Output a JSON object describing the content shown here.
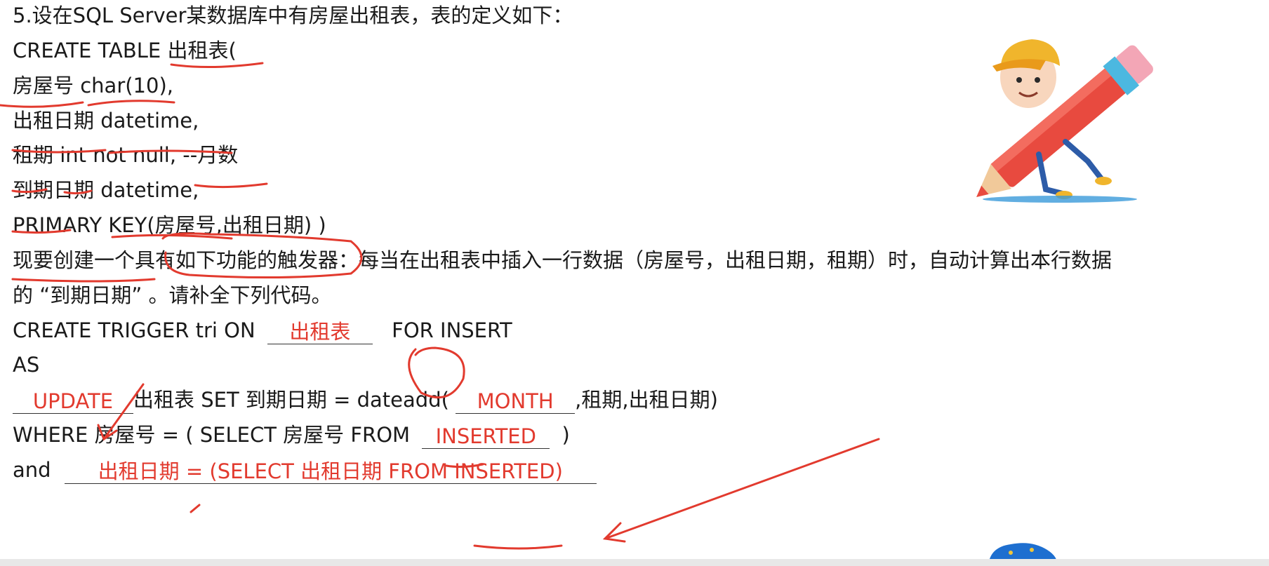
{
  "question": {
    "intro": "5.设在SQL Server某数据库中有房屋出租表，表的定义如下：",
    "create_table": "CREATE TABLE 出租表(",
    "col1": "房屋号 char(10),",
    "col2": "出租日期 datetime,",
    "col3": "租期 int not null, --月数",
    "col4": "到期日期 datetime,",
    "pk": "PRIMARY KEY(房屋号,出租日期) )",
    "desc1": "现要创建一个具有如下功能的触发器：每当在出租表中插入一行数据（房屋号，出租日期，租期）时，自动计算出本行数据",
    "desc2": "的 “到期日期” 。请补全下列代码。"
  },
  "code": {
    "trigger_prefix": "CREATE TRIGGER tri ON",
    "trigger_suffix": "FOR INSERT",
    "as_kw": "AS",
    "update_mid": "出租表 SET 到期日期 = dateadd(",
    "update_tail": ",租期,出租日期)",
    "where_prefix": "WHERE 房屋号 = ( SELECT 房屋号 FROM",
    "where_suffix": ")",
    "and_prefix": "and"
  },
  "answers": {
    "blank1": "出租表",
    "blank2": "UPDATE",
    "blank3": "MONTH",
    "blank4": "INSERTED",
    "blank5": "出租日期 = (SELECT 出租日期 FROM INSERTED)"
  },
  "colors": {
    "annotation_red": "#e23a2e",
    "text": "#1a1a1a"
  }
}
